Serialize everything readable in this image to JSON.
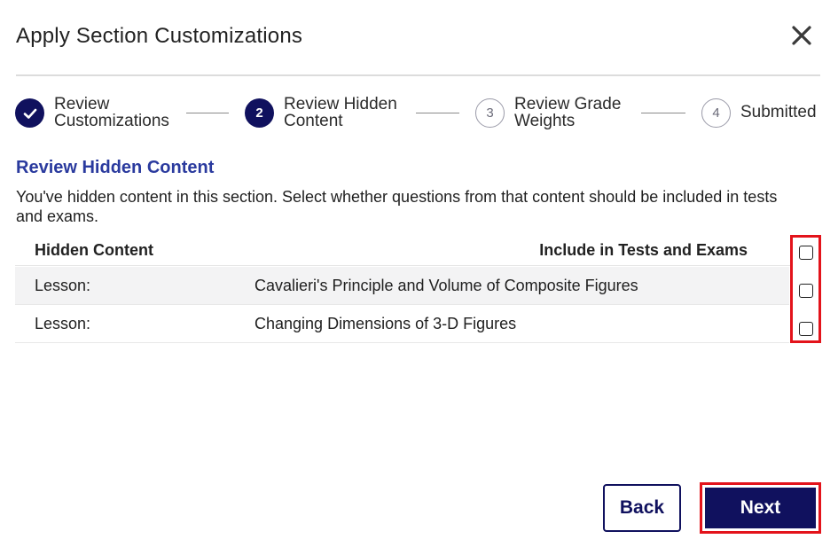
{
  "dialog": {
    "title": "Apply Section Customizations",
    "close_icon": "close-icon"
  },
  "stepper": {
    "steps": [
      {
        "line1": "Review",
        "line2": "Customizations",
        "status": "completed",
        "icon": "checkmark-icon"
      },
      {
        "number": "2",
        "line1": "Review Hidden",
        "line2": "Content",
        "status": "current"
      },
      {
        "number": "3",
        "line1": "Review Grade",
        "line2": "Weights",
        "status": "upcoming"
      },
      {
        "number": "4",
        "line1": "Submitted",
        "status": "upcoming"
      }
    ]
  },
  "section": {
    "heading": "Review Hidden Content",
    "description": "You've hidden content in this section. Select whether questions from that content should be included in tests and exams."
  },
  "table": {
    "headers": {
      "hidden_content": "Hidden Content",
      "include": "Include in Tests and Exams"
    },
    "select_all_checked": false,
    "rows": [
      {
        "type": "Lesson:",
        "title": "Cavalieri's Principle and Volume of Composite Figures",
        "checked": false
      },
      {
        "type": "Lesson:",
        "title": "Changing Dimensions of 3-D Figures",
        "checked": false
      }
    ]
  },
  "footer": {
    "back_label": "Back",
    "next_label": "Next"
  },
  "colors": {
    "primary": "#10115e",
    "heading": "#2a3a9e",
    "highlight": "#e3131b"
  }
}
